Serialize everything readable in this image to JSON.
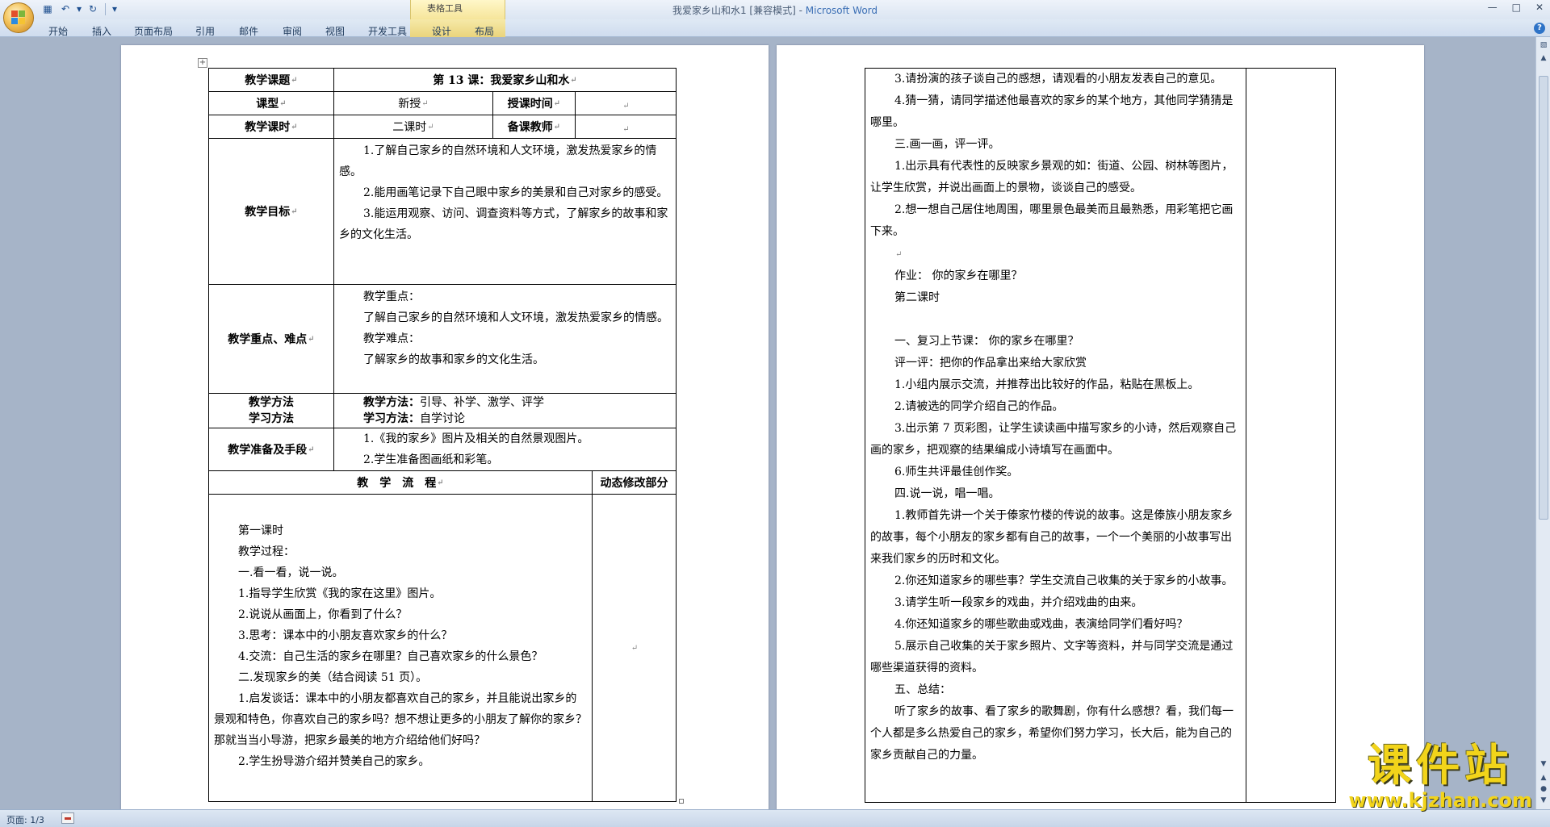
{
  "window": {
    "title": "我爱家乡山和水1 [兼容模式] - ",
    "app_name": "Microsoft Word",
    "contextual_tab_group": "表格工具"
  },
  "ribbon": {
    "tabs": [
      "开始",
      "插入",
      "页面布局",
      "引用",
      "邮件",
      "审阅",
      "视图",
      "开发工具",
      "设计",
      "布局"
    ]
  },
  "status": {
    "page": "页面: 1/3"
  },
  "left_page": {
    "title_label": "教学课题",
    "title_value": "第 13 课：我爱家乡山和水",
    "type_label": "课型",
    "type_value": "新授",
    "time_label": "授课时间",
    "hours_label": "教学课时",
    "hours_value": "二课时",
    "teacher_label": "备课教师",
    "goals_label": "教学目标",
    "goals": [
      "1.了解自己家乡的自然环境和人文环境，激发热爱家乡的情感。",
      "2.能用画笔记录下自己眼中家乡的美景和自己对家乡的感受。",
      "3.能运用观察、访问、调查资料等方式，了解家乡的故事和家乡的文化生活。"
    ],
    "keypoints_label": "教学重点、难点",
    "keypoints": [
      "教学重点：",
      "了解自己家乡的自然环境和人文环境，激发热爱家乡的情感。",
      "教学难点：",
      "了解家乡的故事和家乡的文化生活。"
    ],
    "method_label_1": "教学方法",
    "method_label_2": "学习方法",
    "method_1_key": "教学方法：",
    "method_1_val": "引导、补学、激学、评学",
    "method_2_key": "学习方法：",
    "method_2_val": "自学讨论",
    "prep_label": "教学准备及手段",
    "prep": [
      "1.《我的家乡》图片及相关的自然景观图片。",
      "2.学生准备图画纸和彩笔。"
    ],
    "flow_label": "教　学　流　程",
    "dynamic_label": "动态修改部分",
    "flow": [
      "第一课时",
      "教学过程：",
      "一.看一看，说一说。",
      "1.指导学生欣赏《我的家在这里》图片。",
      "2.说说从画面上，你看到了什么？",
      "3.思考：课本中的小朋友喜欢家乡的什么？",
      "4.交流：自己生活的家乡在哪里？自己喜欢家乡的什么景色？",
      "二.发现家乡的美（结合阅读 51 页）。",
      "1.启发谈话：课本中的小朋友都喜欢自己的家乡，并且能说出家乡的景观和特色，你喜欢自己的家乡吗？想不想让更多的小朋友了解你的家乡？那就当当小导游，把家乡最美的地方介绍给他们好吗？",
      "2.学生扮导游介绍并赞美自己的家乡。"
    ]
  },
  "right_page": {
    "paragraphs": [
      "3.请扮演的孩子谈自己的感想，请观看的小朋友发表自己的意见。",
      "4.猜一猜，请同学描述他最喜欢的家乡的某个地方，其他同学猜猜是哪里。",
      "三.画一画，评一评。",
      "1.出示具有代表性的反映家乡景观的如：街道、公园、树林等图片，让学生欣赏，并说出画面上的景物，谈谈自己的感受。",
      "2.想一想自己居住地周围，哪里景色最美而且最熟悉，用彩笔把它画下来。",
      "",
      "作业：  你的家乡在哪里？",
      "第二课时",
      "",
      "一、复习上节课：  你的家乡在哪里？",
      "评一评：把你的作品拿出来给大家欣赏",
      "1.小组内展示交流，并推荐出比较好的作品，粘贴在黑板上。",
      "2.请被选的同学介绍自己的作品。",
      "3.出示第 7 页彩图，让学生读读画中描写家乡的小诗，然后观察自己画的家乡，把观察的结果编成小诗填写在画面中。",
      "6.师生共评最佳创作奖。",
      "四.说一说，唱一唱。",
      "1.教师首先讲一个关于傣家竹楼的传说的故事。这是傣族小朋友家乡的故事，每个小朋友的家乡都有自己的故事，一个一个美丽的小故事写出来我们家乡的历时和文化。",
      "2.你还知道家乡的哪些事？学生交流自己收集的关于家乡的小故事。",
      "3.请学生听一段家乡的戏曲，并介绍戏曲的由来。",
      "4.你还知道家乡的哪些歌曲或戏曲，表演给同学们看好吗？",
      "5.展示自己收集的关于家乡照片、文字等资料，并与同学交流是通过哪些渠道获得的资料。",
      "五、总结：",
      "听了家乡的故事、看了家乡的歌舞剧，你有什么感想？看，我们每一个人都是多么热爱自己的家乡，希望你们努力学习，长大后，能为自己的家乡贡献自己的力量。"
    ]
  },
  "watermark": {
    "cn": "课件站",
    "url": "www.kjzhan.com"
  }
}
